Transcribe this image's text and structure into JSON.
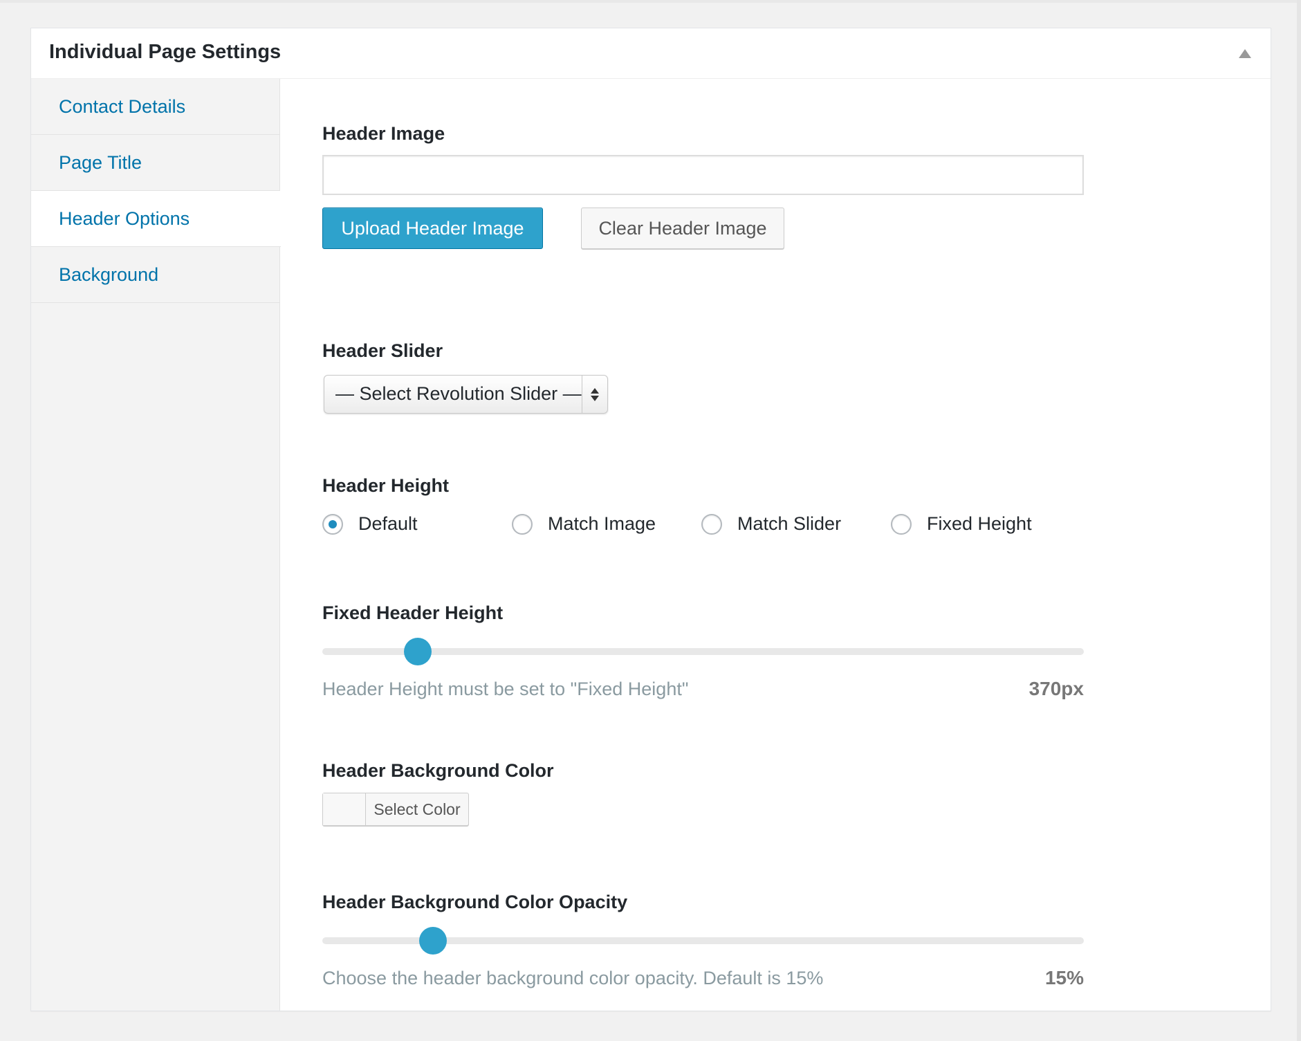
{
  "metabox": {
    "title": "Individual Page Settings"
  },
  "sidebar": {
    "items": [
      {
        "label": "Contact Details",
        "active": false
      },
      {
        "label": "Page Title",
        "active": false
      },
      {
        "label": "Header Options",
        "active": true
      },
      {
        "label": "Background",
        "active": false
      }
    ]
  },
  "header_image": {
    "label": "Header Image",
    "value": "",
    "upload_label": "Upload Header Image",
    "clear_label": "Clear Header Image"
  },
  "header_slider": {
    "label": "Header Slider",
    "selected": "— Select Revolution Slider —"
  },
  "header_height": {
    "label": "Header Height",
    "options": [
      "Default",
      "Match Image",
      "Match Slider",
      "Fixed Height"
    ],
    "selected": "Default"
  },
  "fixed_header_height": {
    "label": "Fixed Header Height",
    "hint": "Header Height must be set to \"Fixed Height\"",
    "value_label": "370px",
    "fraction": 0.125
  },
  "header_bg_color": {
    "label": "Header Background Color",
    "button_label": "Select Color"
  },
  "header_bg_opacity": {
    "label": "Header Background Color Opacity",
    "hint": "Choose the header background color opacity. Default is 15%",
    "value_label": "15%",
    "fraction": 0.145
  },
  "colors": {
    "accent": "#2ea2cc",
    "link": "#0073aa",
    "radio_checked": "#1e8cbe"
  }
}
